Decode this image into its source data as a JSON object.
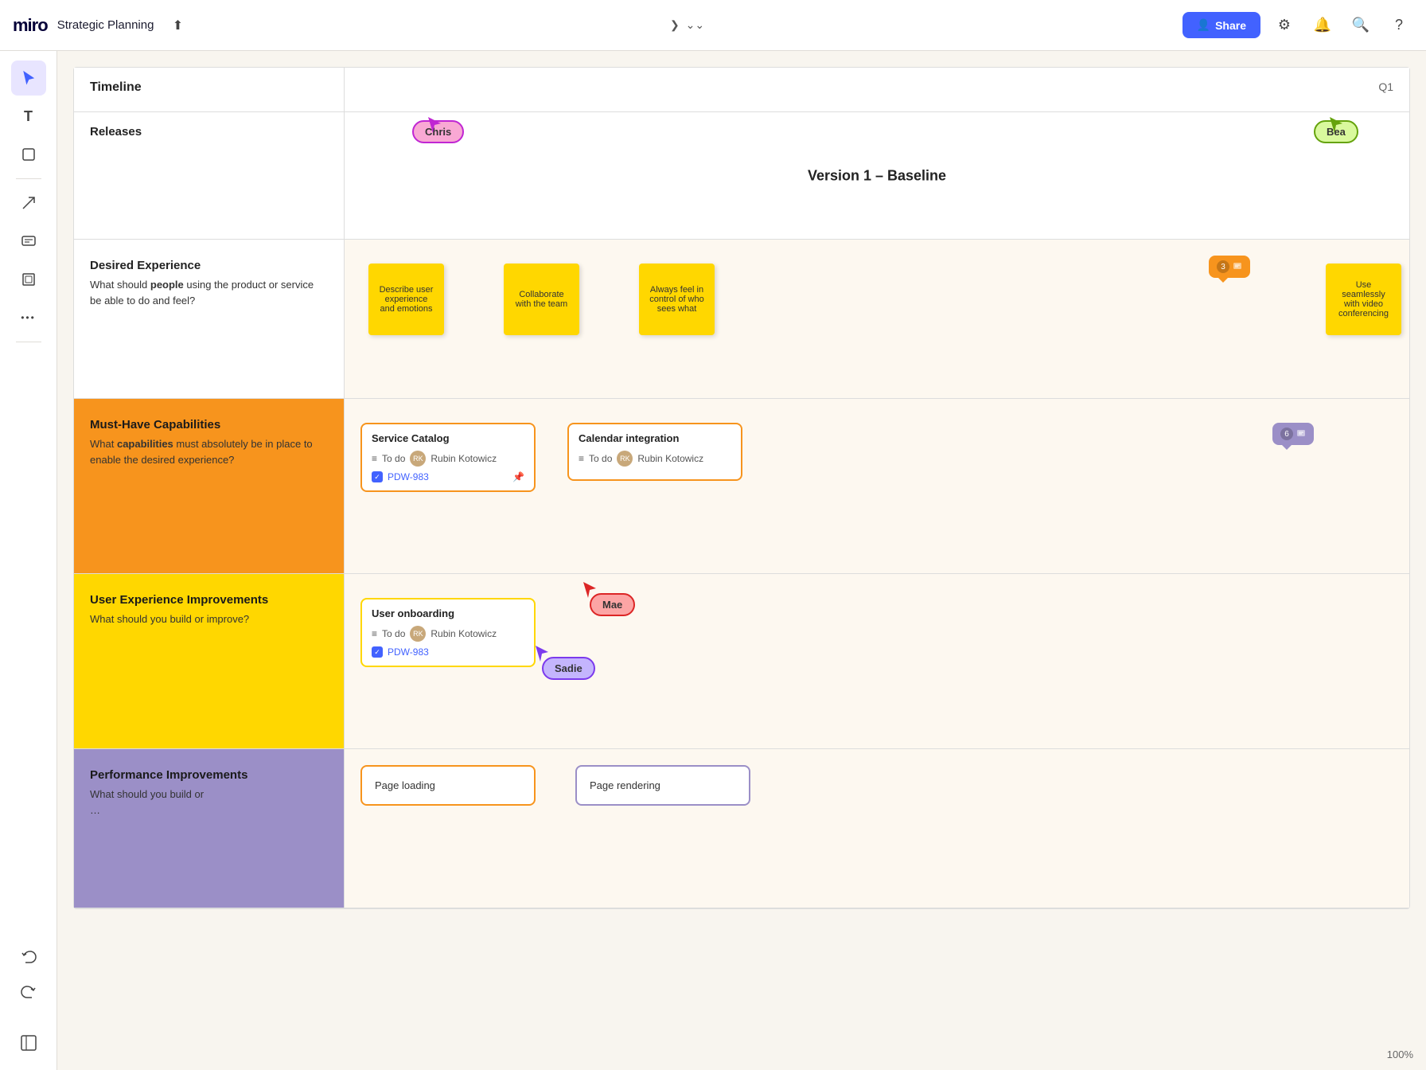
{
  "app": {
    "name": "miro"
  },
  "board": {
    "title": "Strategic Planning"
  },
  "topbar": {
    "share_label": "Share",
    "q1_label": "Q1",
    "zoom_label": "100%"
  },
  "sidebar": {
    "tools": [
      {
        "name": "cursor",
        "icon": "▲",
        "label": "cursor-tool"
      },
      {
        "name": "text",
        "icon": "T",
        "label": "text-tool"
      },
      {
        "name": "note",
        "icon": "◻",
        "label": "note-tool"
      },
      {
        "name": "arrow",
        "icon": "↗",
        "label": "arrow-tool"
      },
      {
        "name": "comment",
        "icon": "💬",
        "label": "comment-tool"
      },
      {
        "name": "frame",
        "icon": "⬜",
        "label": "frame-tool"
      },
      {
        "name": "more",
        "icon": "···",
        "label": "more-tools"
      }
    ]
  },
  "timeline": {
    "header_label": "Timeline",
    "q1_label": "Q1"
  },
  "rows": {
    "releases": {
      "label": "Releases",
      "version": "Version 1 – Baseline"
    },
    "desired_experience": {
      "title": "Desired Experience",
      "description_prefix": "What should ",
      "description_bold": "people",
      "description_suffix": " using the product or service be able to do and feel?"
    },
    "must_have": {
      "title": "Must-Have Capabilities",
      "description_prefix": "What ",
      "description_bold": "capabilities",
      "description_suffix": " must absolutely be in place to enable the desired experience?"
    },
    "ux_improvements": {
      "title": "User Experience Improvements",
      "description": "What should you build or improve?"
    },
    "performance": {
      "title": "Performance Improvements",
      "description": "What should you build or"
    }
  },
  "stickies": [
    {
      "id": "s1",
      "text": "Describe  user experience and emotions",
      "color": "yellow"
    },
    {
      "id": "s2",
      "text": "Collaborate with the team",
      "color": "yellow"
    },
    {
      "id": "s3",
      "text": "Always feel in control of who sees what",
      "color": "yellow"
    },
    {
      "id": "s4",
      "text": "Use seamlessly with video conferencing",
      "color": "yellow"
    }
  ],
  "cursors": [
    {
      "name": "Chris",
      "color_bg": "#f9a8d4",
      "color_text": "#c026d3"
    },
    {
      "name": "Bea",
      "color_bg": "#d9f99d",
      "color_text": "#65a30d"
    },
    {
      "name": "Mae",
      "color_bg": "#fca5a5",
      "color_text": "#dc2626"
    },
    {
      "name": "Sadie",
      "color_bg": "#c4b5fd",
      "color_text": "#7c3aed"
    }
  ],
  "task_cards": [
    {
      "id": "tc1",
      "title": "Service Catalog",
      "status": "To do",
      "assignee": "Rubin Kotowicz",
      "ticket": "PDW-983"
    },
    {
      "id": "tc2",
      "title": "Calendar integration",
      "status": "To do",
      "assignee": "Rubin Kotowicz",
      "ticket": ""
    },
    {
      "id": "tc3",
      "title": "User onboarding",
      "status": "To do",
      "assignee": "Rubin Kotowicz",
      "ticket": "PDW-983"
    }
  ],
  "page_cards": [
    {
      "id": "pc1",
      "title": "Page loading"
    },
    {
      "id": "pc2",
      "title": "Page rendering"
    }
  ],
  "comments": [
    {
      "count": "3"
    },
    {
      "count": "6"
    }
  ]
}
